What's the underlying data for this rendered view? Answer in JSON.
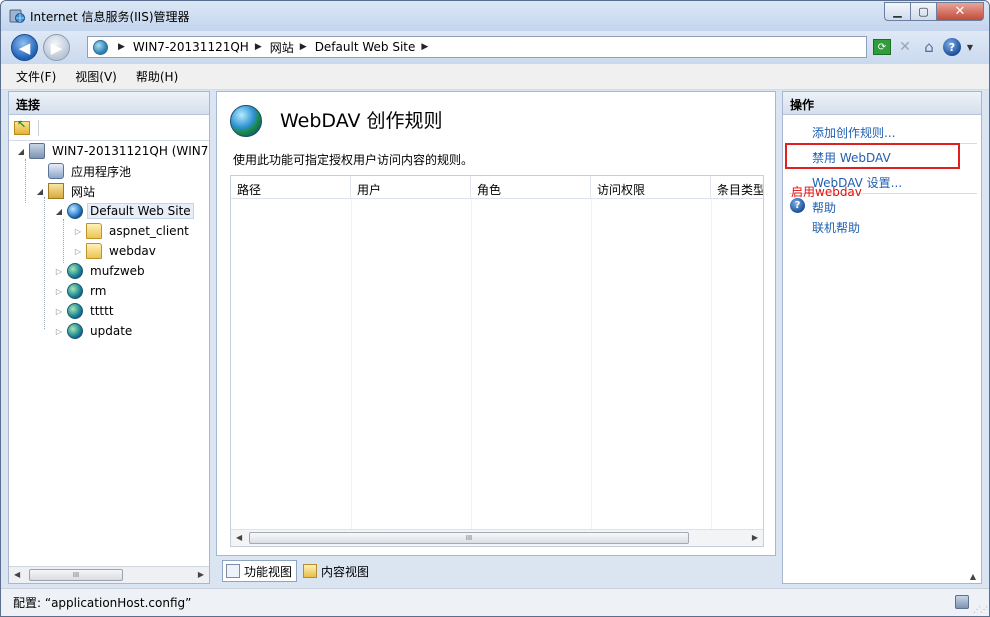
{
  "window": {
    "title": "Internet 信息服务(IIS)管理器",
    "minimize_glyph": "▁",
    "maximize_glyph": "▢",
    "close_glyph": "✕"
  },
  "navigation": {
    "back_glyph": "◀",
    "forward_glyph": "▶",
    "breadcrumb": [
      "WIN7-20131121QH",
      "网站",
      "Default Web Site"
    ],
    "separator": "▶",
    "tools": {
      "refresh_glyph": "⟳",
      "stop_glyph": "✕",
      "home_glyph": "⌂",
      "help_glyph": "?",
      "dropdown_glyph": "▼"
    }
  },
  "menu": [
    "文件(F)",
    "视图(V)",
    "帮助(H)"
  ],
  "connections": {
    "title": "连接",
    "tree": [
      {
        "label": "WIN7-20131121QH (WIN7",
        "icon": "server-icon",
        "expanded": true
      },
      {
        "label": "应用程序池",
        "icon": "app-pool-icon"
      },
      {
        "label": "网站",
        "icon": "sites-folder-icon",
        "expanded": true
      },
      {
        "label": "Default Web Site",
        "icon": "globe-icon",
        "expanded": true,
        "selected": true
      },
      {
        "label": "aspnet_client",
        "icon": "folder-icon"
      },
      {
        "label": "webdav",
        "icon": "folder-icon"
      },
      {
        "label": "mufzweb",
        "icon": "globe-icon"
      },
      {
        "label": "rm",
        "icon": "globe-icon"
      },
      {
        "label": "ttttt",
        "icon": "globe-icon"
      },
      {
        "label": "update",
        "icon": "globe-icon"
      }
    ],
    "scroll_left": "◀",
    "scroll_right": "▶",
    "scroll_grip": "III"
  },
  "feature": {
    "title": "WebDAV 创作规则",
    "description": "使用此功能可指定授权用户访问内容的规则。",
    "columns": [
      "路径",
      "用户",
      "角色",
      "访问权限",
      "条目类型"
    ],
    "rows": [],
    "scroll_left": "◀",
    "scroll_right": "▶",
    "scroll_grip": "III"
  },
  "view_tabs": {
    "features": "功能视图",
    "content": "内容视图"
  },
  "actions": {
    "title": "操作",
    "items": [
      "添加创作规则...",
      "禁用 WebDAV",
      "WebDAV 设置...",
      "帮助",
      "联机帮助"
    ],
    "annotation": "启用webdav",
    "collapse_glyph": "▲"
  },
  "status": {
    "text": "配置: “applicationHost.config”",
    "grip": "⋰⋰"
  },
  "colors": {
    "link": "#1f5fb0",
    "highlight_box": "#e02020"
  }
}
